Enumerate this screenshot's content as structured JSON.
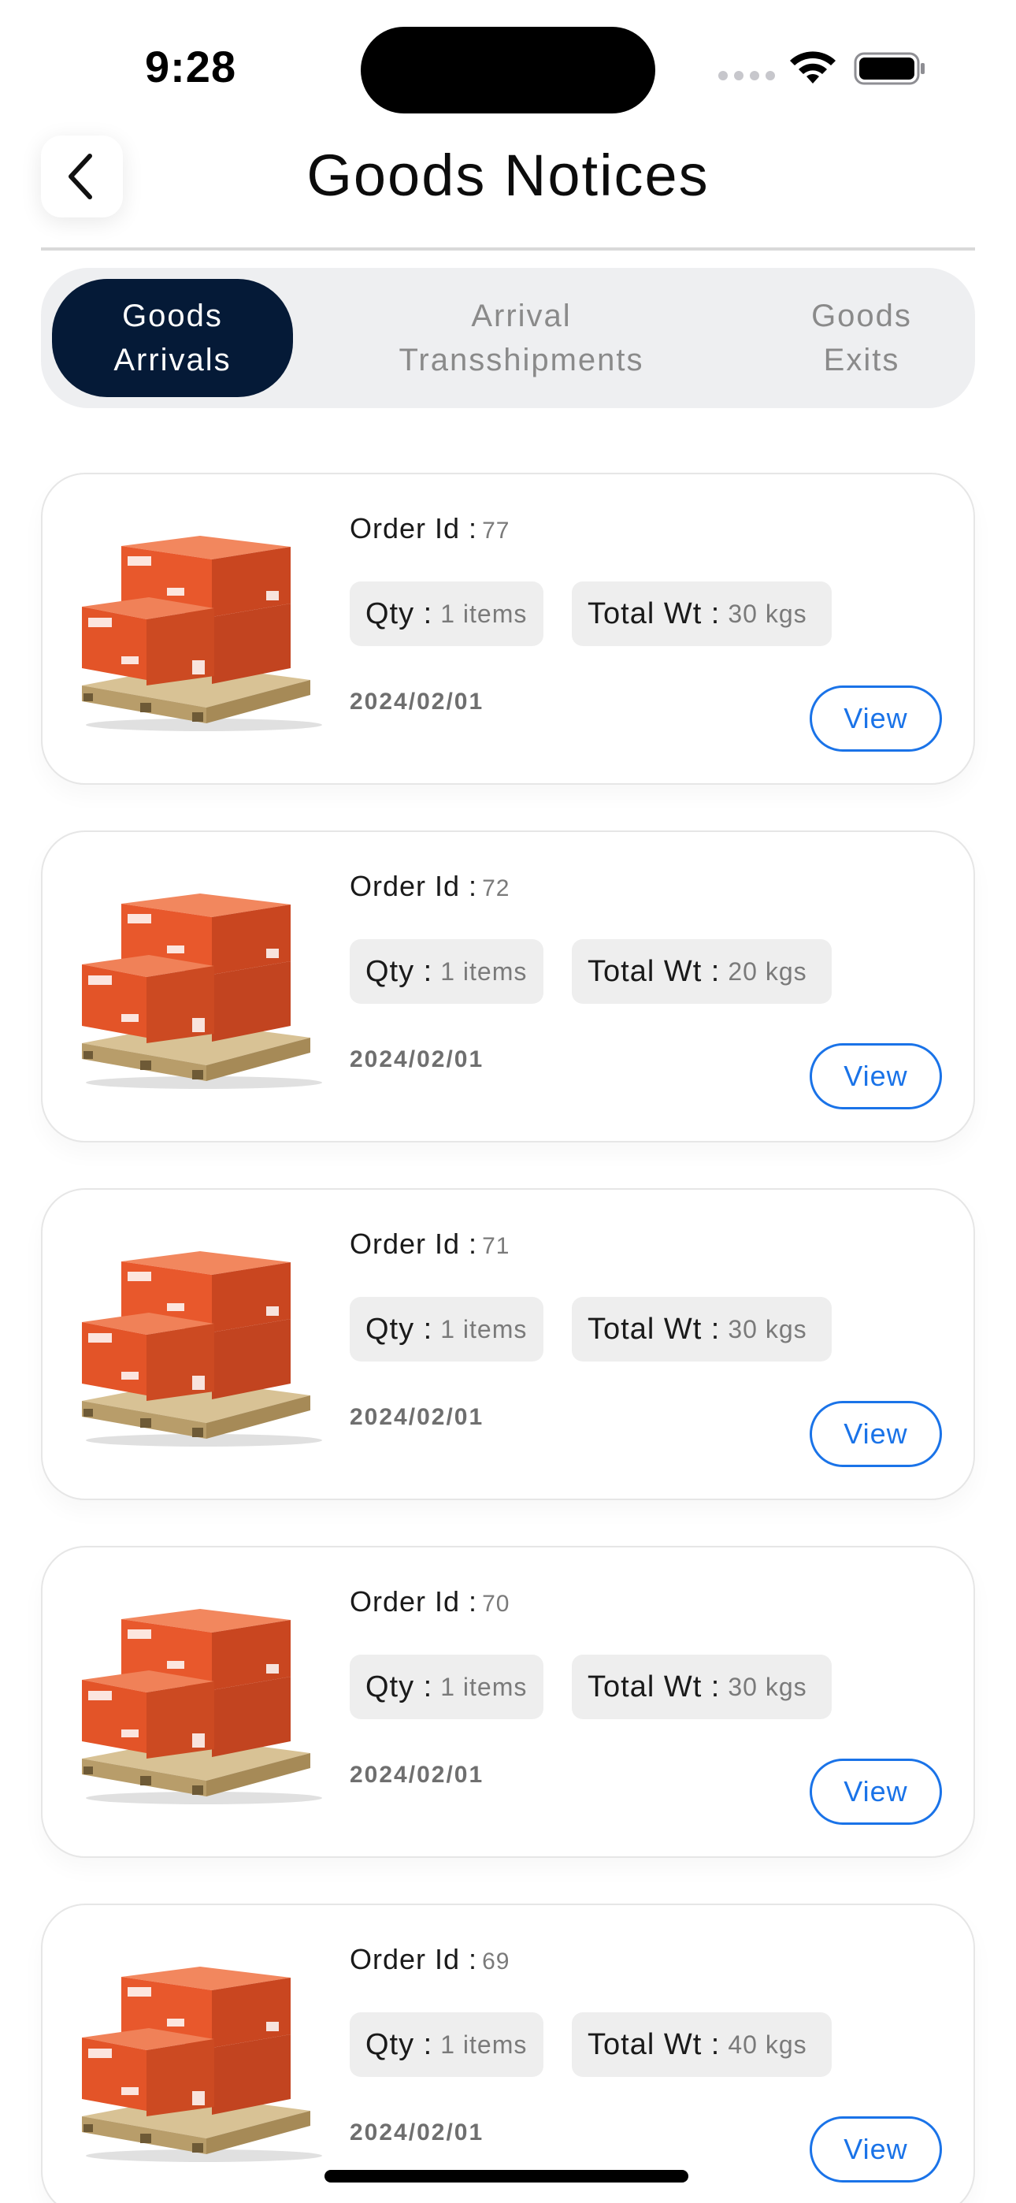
{
  "status_bar": {
    "time": "9:28"
  },
  "header": {
    "title": "Goods Notices"
  },
  "tabs": [
    {
      "label": "Goods\nArrivals",
      "active": true
    },
    {
      "label": "Arrival\nTransshipments",
      "active": false
    },
    {
      "label": "Goods\nExits",
      "active": false
    }
  ],
  "labels": {
    "order_id": "Order Id :",
    "qty": "Qty :",
    "total_wt": "Total Wt :",
    "view": "View"
  },
  "orders": [
    {
      "order_id": "77",
      "qty": "1 items",
      "total_wt": "30 kgs",
      "date": "2024/02/01"
    },
    {
      "order_id": "72",
      "qty": "1 items",
      "total_wt": "20 kgs",
      "date": "2024/02/01"
    },
    {
      "order_id": "71",
      "qty": "1 items",
      "total_wt": "30 kgs",
      "date": "2024/02/01"
    },
    {
      "order_id": "70",
      "qty": "1 items",
      "total_wt": "30 kgs",
      "date": "2024/02/01"
    },
    {
      "order_id": "69",
      "qty": "1 items",
      "total_wt": "40 kgs",
      "date": "2024/02/01"
    }
  ],
  "colors": {
    "accent": "#1a73e8",
    "active_tab": "#051a37",
    "box": "#e8582c",
    "pallet": "#cdb68a"
  },
  "icons": {
    "back": "chevron-left-icon",
    "wifi": "wifi-icon",
    "battery": "battery-icon",
    "product": "boxes-on-pallet-image"
  }
}
